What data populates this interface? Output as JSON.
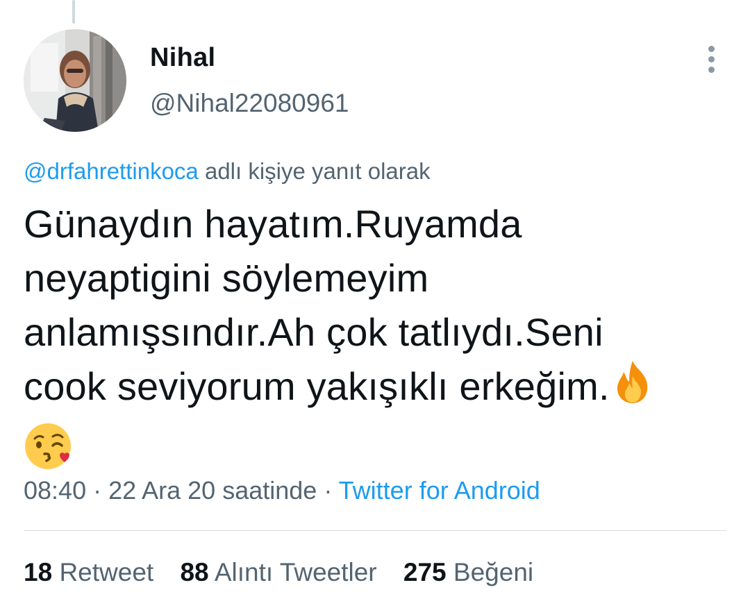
{
  "tweet": {
    "author": {
      "display_name": "Nihal",
      "handle": "@Nihal22080961"
    },
    "reply_to": {
      "mention": "@drfahrettinkoca",
      "suffix": "adlı kişiye yanıt olarak"
    },
    "text_lines": [
      "Günaydın hayatım.Ruyamda",
      "neyaptigini söylemeyim",
      "anlamışsındır.Ah çok tatlıydı.Seni",
      "cook seviyorum yakışıklı erkeğim."
    ],
    "emojis": [
      "fire-emoji",
      "kissing-face-with-heart-emoji"
    ],
    "timestamp": "08:40 · 22 Ara 20 saatinde ·",
    "source": "Twitter for Android"
  },
  "stats": {
    "retweets": {
      "count": "18",
      "label": "Retweet"
    },
    "quotes": {
      "count": "88",
      "label": "Alıntı Tweetler"
    },
    "likes": {
      "count": "275",
      "label": "Beğeni"
    }
  },
  "colors": {
    "link": "#1d9bf0",
    "secondary_text": "#536471",
    "primary_text": "#0f1419"
  }
}
